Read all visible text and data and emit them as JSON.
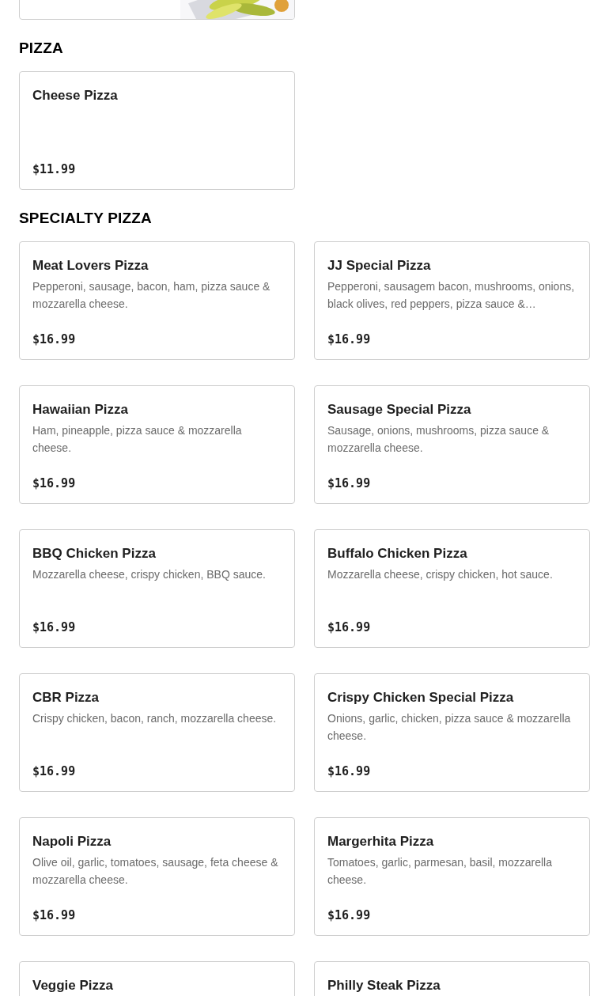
{
  "sections": [
    {
      "heading": "PIZZA",
      "items": [
        {
          "name": "Cheese Pizza",
          "price": "$11.99"
        }
      ]
    },
    {
      "heading": "SPECIALTY PIZZA",
      "items": [
        {
          "name": "Meat Lovers Pizza",
          "description": "Pepperoni, sausage, bacon, ham, pizza sauce & mozzarella cheese.",
          "price": "$16.99"
        },
        {
          "name": "JJ Special Pizza",
          "description": "Pepperoni, sausagem bacon, mushrooms, onions, black olives, red peppers, pizza sauce &…",
          "price": "$16.99"
        },
        {
          "name": "Hawaiian Pizza",
          "description": "Ham, pineapple, pizza sauce & mozzarella cheese.",
          "price": "$16.99"
        },
        {
          "name": "Sausage Special Pizza",
          "description": "Sausage, onions, mushrooms, pizza sauce & mozzarella cheese.",
          "price": "$16.99"
        },
        {
          "name": "BBQ Chicken Pizza",
          "description": "Mozzarella cheese, crispy chicken, BBQ sauce.",
          "price": "$16.99"
        },
        {
          "name": "Buffalo Chicken Pizza",
          "description": "Mozzarella cheese, crispy chicken, hot sauce.",
          "price": "$16.99"
        },
        {
          "name": "CBR Pizza",
          "description": "Crispy chicken, bacon, ranch, mozzarella cheese.",
          "price": "$16.99"
        },
        {
          "name": "Crispy Chicken Special Pizza",
          "description": "Onions, garlic, chicken, pizza sauce & mozzarella cheese.",
          "price": "$16.99"
        },
        {
          "name": "Napoli Pizza",
          "description": "Olive oil, garlic, tomatoes, sausage, feta cheese & mozzarella cheese.",
          "price": "$16.99"
        },
        {
          "name": "Margerhita Pizza",
          "description": "Tomatoes, garlic, parmesan, basil, mozzarella cheese.",
          "price": "$16.99"
        },
        {
          "name": "Veggie Pizza"
        },
        {
          "name": "Philly Steak Pizza"
        }
      ]
    }
  ]
}
